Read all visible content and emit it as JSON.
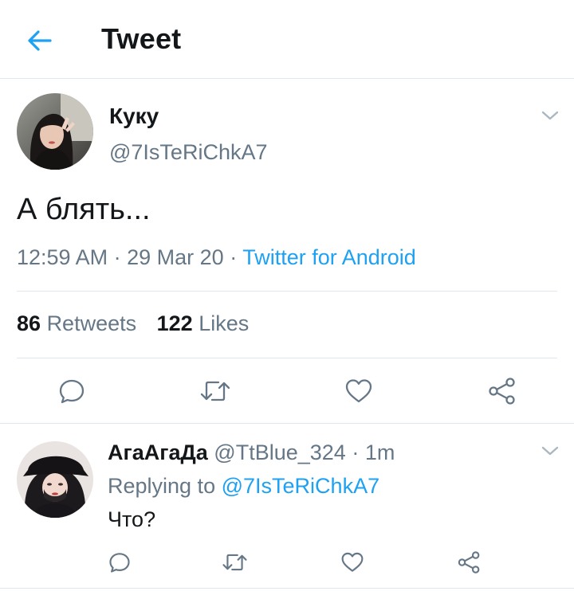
{
  "header": {
    "back_icon": "arrow-left-icon",
    "title": "Tweet"
  },
  "colors": {
    "accent": "#1da1f2",
    "text": "#14171a",
    "muted": "#657786",
    "divider": "#e1e8ed"
  },
  "tweet": {
    "author_name": "Куку",
    "author_handle": "@7IsTeRiChkA7",
    "text": "А блять...",
    "time": "12:59 AM",
    "date": "29 Mar 20",
    "separator": "·",
    "source": "Twitter for Android",
    "retweets_count": "86",
    "retweets_label": "Retweets",
    "likes_count": "122",
    "likes_label": "Likes",
    "actions": [
      "reply-icon",
      "retweet-icon",
      "like-icon",
      "share-icon"
    ]
  },
  "reply": {
    "author_name": "АгаАгаДа",
    "author_handle": "@TtBlue_324",
    "separator": "·",
    "time": "1m",
    "replying_to_label": "Replying to",
    "replying_to_handle": "@7IsTeRiChkA7",
    "text": "Что?",
    "actions": [
      "reply-icon",
      "retweet-icon",
      "like-icon",
      "share-icon"
    ]
  }
}
